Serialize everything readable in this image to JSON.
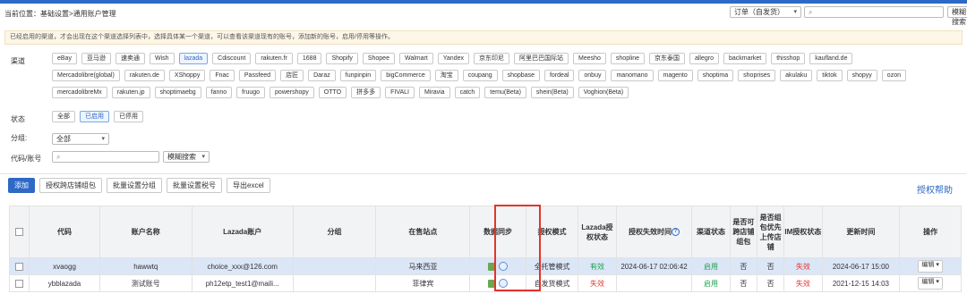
{
  "breadcrumb": {
    "prefix": "当前位置：",
    "path": "基础设置>通用账户管理"
  },
  "header": {
    "order_select": "订单（自发货）",
    "search_placeholder": "",
    "fuzzy_search": "模糊搜索"
  },
  "notice": "已经启用的渠道，才会出现在这个渠道选择列表中，选择具体某一个渠道，可以查看该渠道现有的账号，添加新的账号，启用/停用等操作。",
  "filters": {
    "channel_label": "渠道",
    "channels": [
      "eBay",
      "亚马逊",
      "速卖通",
      "Wish",
      "lazada",
      "Cdiscount",
      "rakuten.fr",
      "1688",
      "Shopify",
      "Shopee",
      "Walmart",
      "Yandex",
      "京东印尼",
      "阿里巴巴国际站",
      "Meesho",
      "shopline",
      "京东泰国",
      "allegro",
      "backmarket",
      "thisshop",
      "kaufland.de",
      "Mercadolibre(global)",
      "rakuten.de",
      "XShoppy",
      "Fnac",
      "Passfeed",
      "店匠",
      "Daraz",
      "funpinpin",
      "bigCommerce",
      "淘宝",
      "coupang",
      "shopbase",
      "fordeal",
      "onbuy",
      "manomano",
      "magento",
      "shoptima",
      "shoprises",
      "akulaku",
      "tiktok",
      "shopyy",
      "ozon",
      "mercadolibreMx",
      "rakuten.jp",
      "shoptimaebg",
      "fanno",
      "fruugo",
      "powershopy",
      "OTTO",
      "拼多多",
      "FIVALI",
      "Miravia",
      "catch",
      "temu(Beta)",
      "shein(Beta)",
      "Voghion(Beta)"
    ],
    "active_channel": "lazada",
    "status_label": "状态",
    "statuses": [
      "全部",
      "已启用",
      "已停用"
    ],
    "active_status": "已启用",
    "group_label": "分组:",
    "group_value": "全部",
    "code_label": "代码/账号",
    "code_placeholder": "",
    "fuzzy_search": "模糊搜索"
  },
  "toolbar": {
    "buttons": [
      "添加",
      "授权跨店铺组包",
      "批量设置分组",
      "批量设置税号",
      "导出excel"
    ],
    "help": "授权帮助"
  },
  "table": {
    "headers": [
      "代码",
      "账户名称",
      "Lazada账户",
      "分组",
      "在售站点",
      "数据同步",
      "授权模式",
      "Lazada授权状态",
      "授权失效时间",
      "渠道状态",
      "是否可跨店铺组包",
      "是否组包优先上传店铺",
      "IM授权状态",
      "更新时间",
      "操作"
    ],
    "rows": [
      {
        "code": "xvaogg",
        "name": "hawwtq",
        "account": "choice_xxx@126.com",
        "group": "",
        "site": "马来西亚",
        "mode": "全托管模式",
        "auth": "有效",
        "expire": "2024-06-17 02:06:42",
        "channel": "启用",
        "cross": "否",
        "priority": "否",
        "im": "失效",
        "updated": "2024-06-17 15:00",
        "op": "编辑"
      },
      {
        "code": "ybblazada",
        "name": "测试账号",
        "account": "ph12etp_test1@maili...",
        "group": "",
        "site": "菲律宾",
        "mode": "自发货模式",
        "auth": "失效",
        "expire": "",
        "channel": "启用",
        "cross": "否",
        "priority": "否",
        "im": "失效",
        "updated": "2021-12-15 14:03",
        "op": "编辑"
      }
    ]
  }
}
